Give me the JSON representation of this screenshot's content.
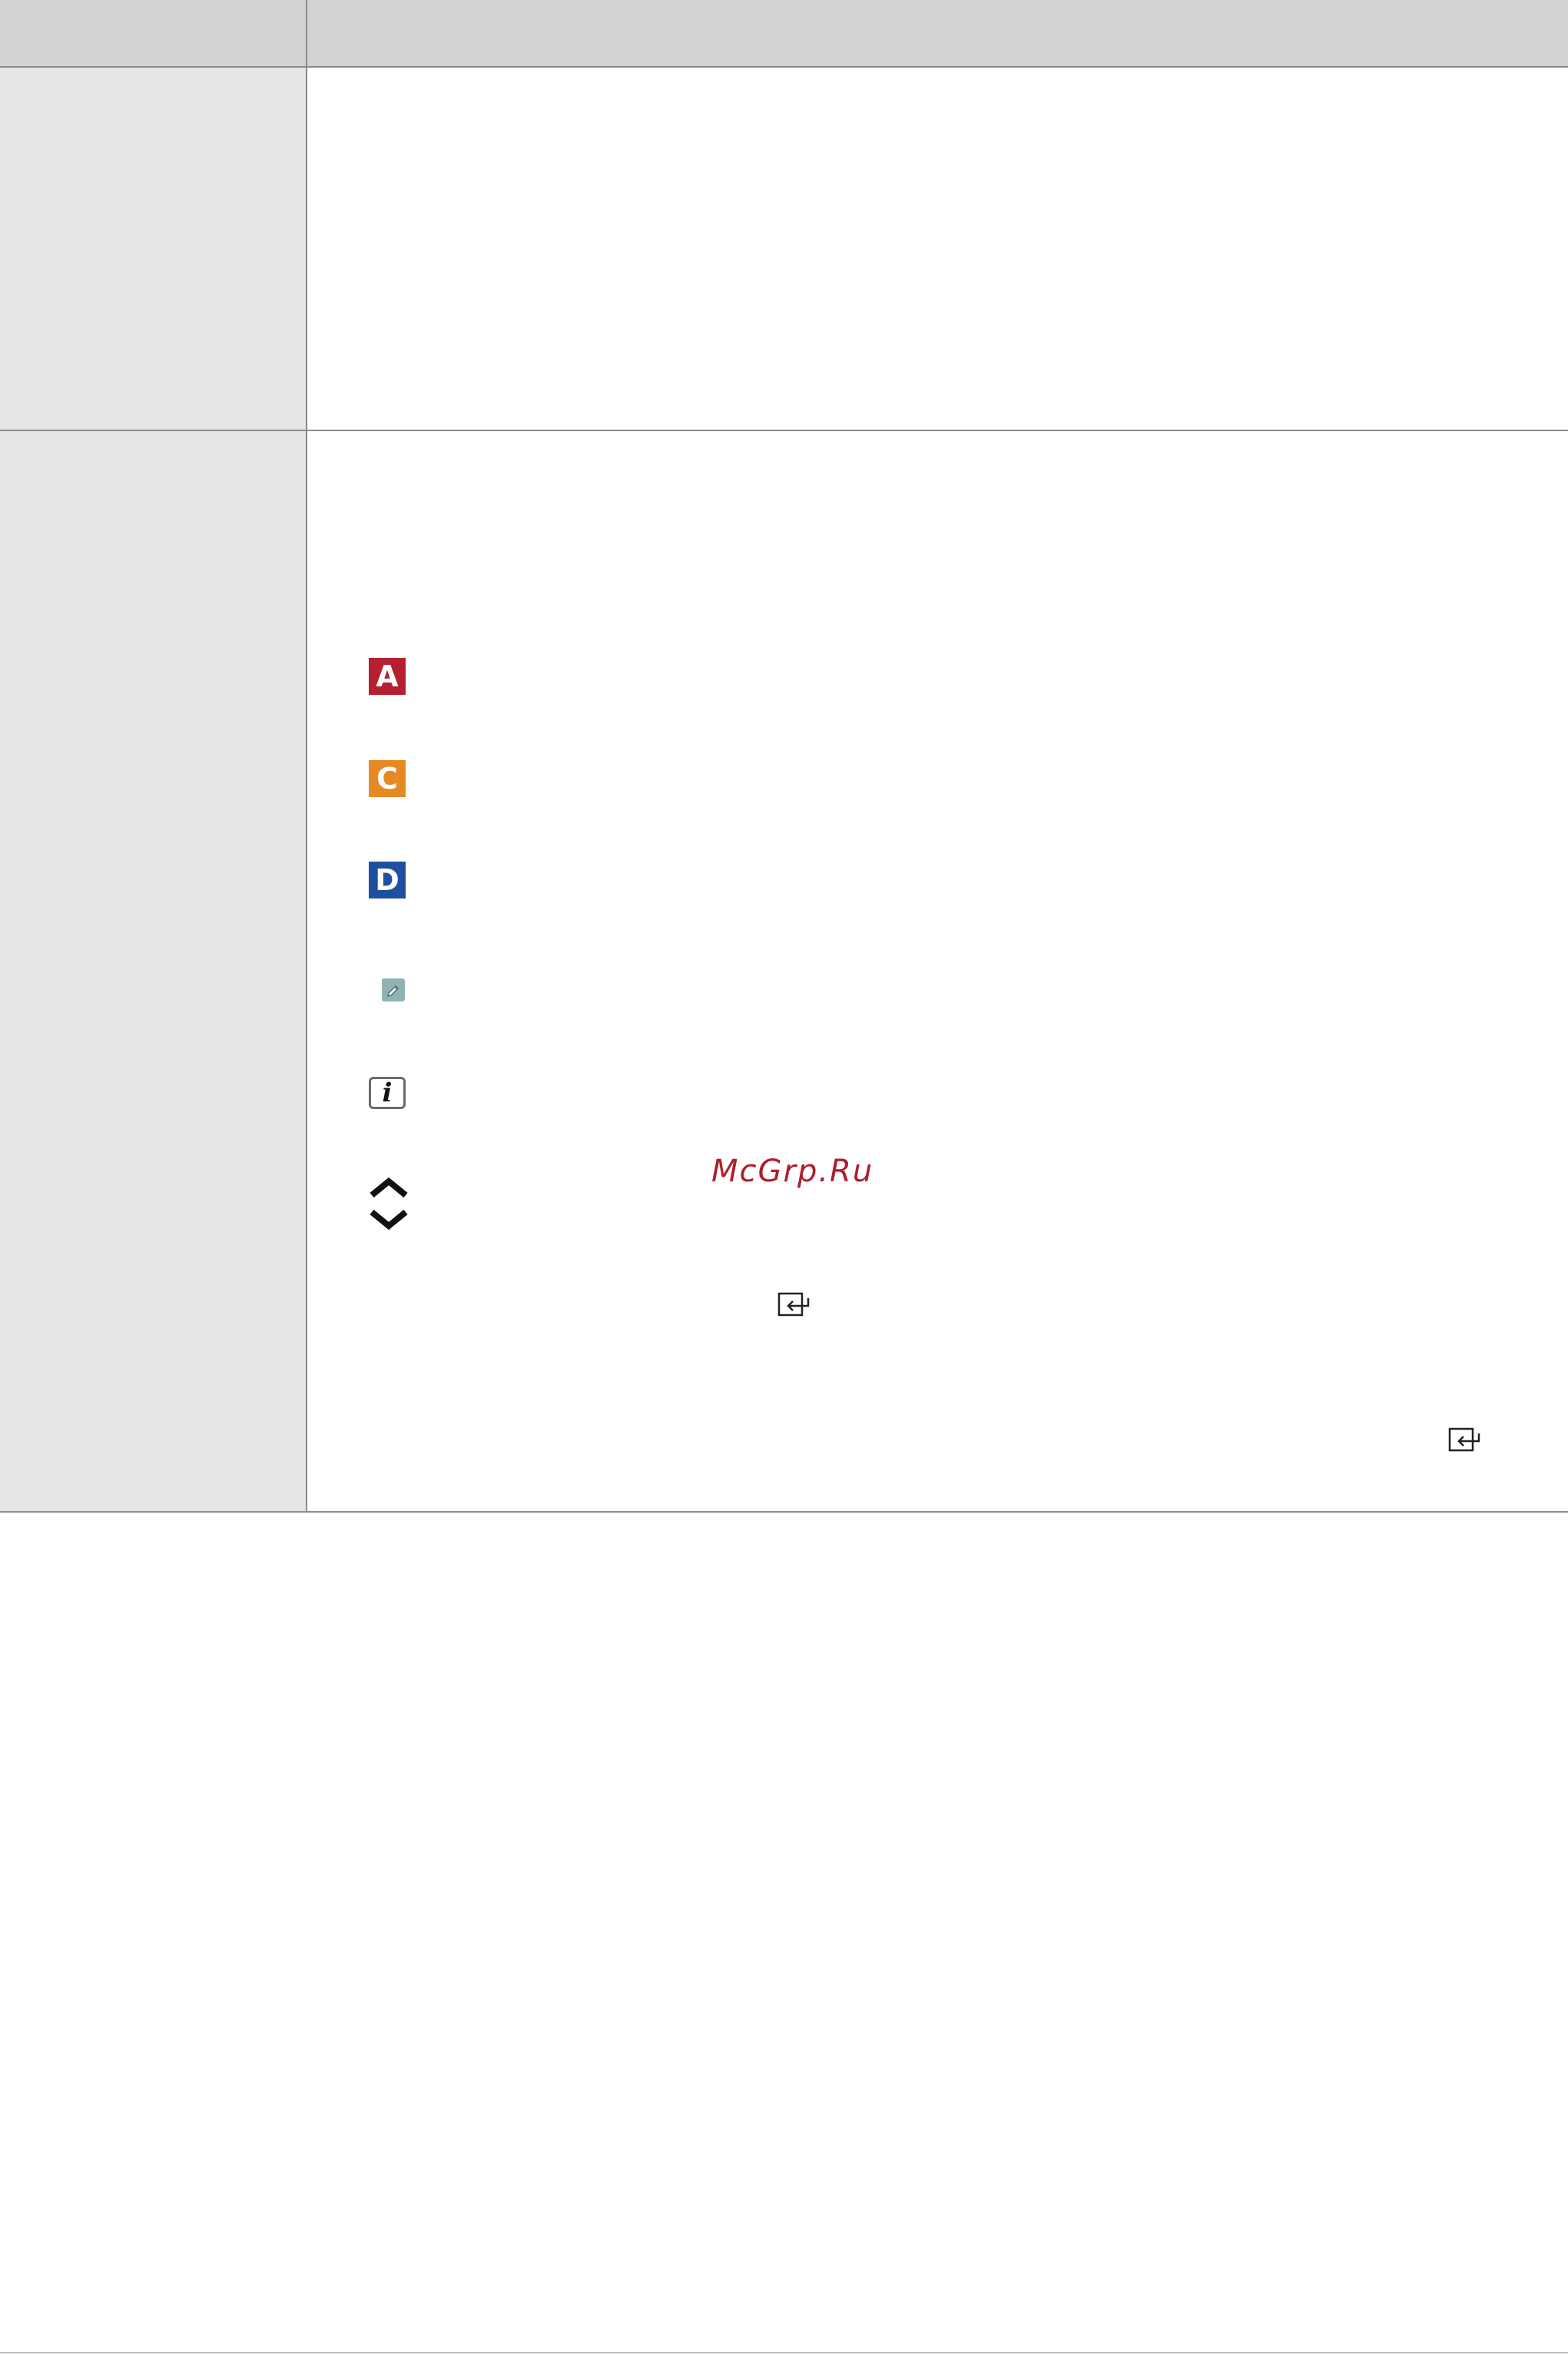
{
  "watermark": {
    "text": "McGrp.Ru",
    "color": "#b01c2c"
  },
  "table": {
    "header_color": "#d2d3d5",
    "label_column_color": "#e6e6e6",
    "rows": [
      {
        "label": "",
        "description": ""
      },
      {
        "label": "",
        "description": ""
      }
    ]
  },
  "icons": {
    "button_a": {
      "letter": "A",
      "color": "#b51f2e",
      "name": "red-a-button-icon"
    },
    "button_c": {
      "letter": "C",
      "color": "#e58a23",
      "name": "yellow-c-button-icon"
    },
    "button_d": {
      "letter": "D",
      "color": "#1f4fa0",
      "name": "blue-d-button-icon"
    },
    "edit": {
      "name": "edit-pencil-icon",
      "color": "#8fb3b3"
    },
    "info": {
      "letter": "i",
      "name": "info-button-icon"
    },
    "updown": {
      "name": "up-down-arrows-icon"
    },
    "enter": {
      "name": "enter-icon"
    }
  }
}
